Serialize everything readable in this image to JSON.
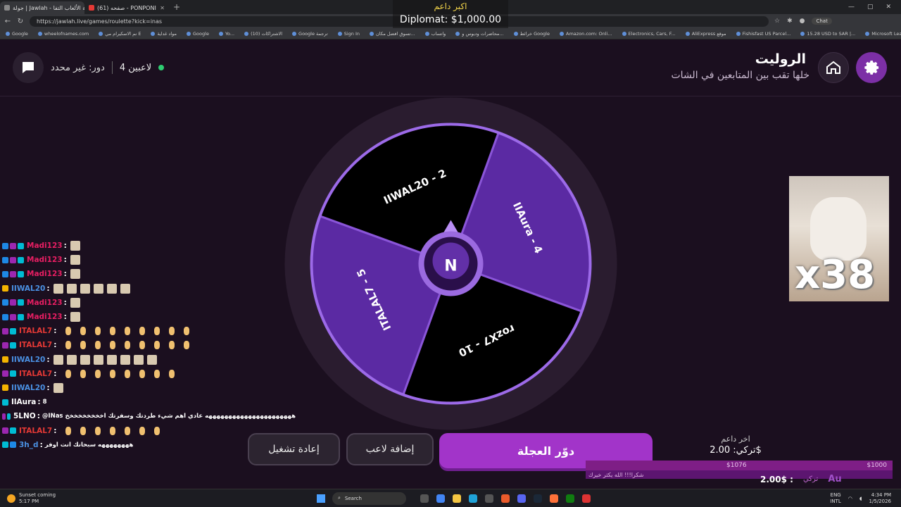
{
  "browser": {
    "tabs": [
      {
        "title": "جولة | Jawlah - منصة الألعاب التفا"
      },
      {
        "title": "(61) صفحه - PONPONI"
      }
    ],
    "url": "https://jawlah.live/games/roulette?kick=inas",
    "chat_button": "Chat",
    "bookmarks": [
      "Google",
      "wheelofnames.com",
      "نم الاسكيرام مي E",
      "مواد غداية",
      "Google",
      "Yo...",
      "(10) الاشتراكات",
      "Google ترجمة",
      "Sign In",
      "تسوق افضل مكان...",
      "واتساب",
      "محاضرات وديوس و...",
      "خرائط Google",
      "Amazon.com: Onli...",
      "Electronics, Cars, F...",
      "AliExpress موقع",
      "Fishisfast US Parcel...",
      "15.28 USD to SAR |...",
      "Microsoft Learning"
    ],
    "bookmarks_right": "الطقس"
  },
  "overlay": {
    "top_label": "اكبر داعم",
    "top_amount": "Diplomat: $1,000.00"
  },
  "header": {
    "title": "الروليت",
    "subtitle": "خلها تقب بين المتابعين في الشات",
    "players": "4 لاعبين",
    "role": "دور: غير محدد"
  },
  "wheel": {
    "segments": [
      {
        "label": "IIAura - 4",
        "color": "#5b2aa3"
      },
      {
        "label": "rozX7 - 10",
        "color": "#000000"
      },
      {
        "label": "ITALAL7 - 5",
        "color": "#5b2aa3"
      },
      {
        "label": "IIWAL20 - 2",
        "color": "#000000"
      }
    ],
    "center_letter": "N"
  },
  "chat": [
    {
      "badges": [
        "blue",
        "purple",
        "teal"
      ],
      "user": "Madi123",
      "color": "#e91e63",
      "emotes": 1,
      "type": "cat"
    },
    {
      "badges": [
        "blue",
        "purple",
        "teal"
      ],
      "user": "Madi123",
      "color": "#e91e63",
      "emotes": 1,
      "type": "cat"
    },
    {
      "badges": [
        "blue",
        "purple",
        "teal"
      ],
      "user": "Madi123",
      "color": "#e91e63",
      "emotes": 1,
      "type": "cat"
    },
    {
      "badges": [
        "gold"
      ],
      "user": "IIWAL20",
      "color": "#4a90e2",
      "emotes": 6,
      "type": "cat"
    },
    {
      "badges": [
        "blue",
        "purple",
        "teal"
      ],
      "user": "Madi123",
      "color": "#e91e63",
      "emotes": 1,
      "type": "cat"
    },
    {
      "badges": [
        "blue",
        "purple",
        "teal"
      ],
      "user": "Madi123",
      "color": "#e91e63",
      "emotes": 1,
      "type": "cat"
    },
    {
      "badges": [
        "purple",
        "teal"
      ],
      "user": "ITALAL7",
      "color": "#e53935",
      "emotes": 9,
      "type": "small"
    },
    {
      "badges": [
        "purple",
        "teal"
      ],
      "user": "ITALAL7",
      "color": "#e53935",
      "emotes": 9,
      "type": "small"
    },
    {
      "badges": [
        "gold"
      ],
      "user": "IIWAL20",
      "color": "#4a90e2",
      "emotes": 8,
      "type": "cat"
    },
    {
      "badges": [
        "purple",
        "teal"
      ],
      "user": "ITALAL7",
      "color": "#e53935",
      "emotes": 8,
      "type": "small"
    },
    {
      "badges": [
        "gold"
      ],
      "user": "IIWAL20",
      "color": "#4a90e2",
      "emotes": 1,
      "type": "cat"
    },
    {
      "badges": [
        "teal"
      ],
      "user": "IlAura",
      "color": "#ffffff",
      "text": "8"
    },
    {
      "badges": [
        "purple",
        "teal"
      ],
      "user": "5LNO",
      "color": "#ffffff",
      "text": "@INas ههههههههههههههههههههههه عادي اهم شيء طردتك وسفرتك اخخخخخخخخخ"
    },
    {
      "badges": [
        "purple",
        "teal"
      ],
      "user": "ITALAL7",
      "color": "#e53935",
      "emotes": 7,
      "type": "small"
    },
    {
      "badges": [
        "teal",
        "blue"
      ],
      "user": "3h_d",
      "color": "#4a90e2",
      "text": "ههههههههه سبحانك انت اوفر"
    }
  ],
  "buttons": {
    "restart": "إعادة تشغيل",
    "add_player": "إضافة لاعب",
    "spin": "دوّر العجلة"
  },
  "cat_gif": {
    "count": "x38"
  },
  "donations": {
    "last_title": "اخر داعم",
    "last_amount": "تركي: 2.00$",
    "goal_left": "$1076",
    "goal_right": "$1000",
    "goal_message": "شكرا!!! الله يكثر خيرك",
    "ticker_amount": "2.00$ :",
    "ticker_name": "تركي",
    "ticker_logo": "Au"
  },
  "taskbar": {
    "weather_title": "Sunset coming",
    "weather_time": "5:17 PM",
    "search": "Search",
    "lang1": "ENG",
    "lang2": "INTL",
    "time": "4:34 PM",
    "date": "1/5/2026"
  }
}
